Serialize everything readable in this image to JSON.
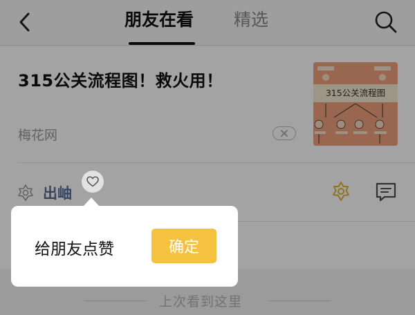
{
  "header": {
    "tabs": [
      {
        "label": "朋友在看",
        "active": true
      },
      {
        "label": "精选",
        "active": false
      }
    ],
    "back_icon": "chevron-left-icon",
    "search_icon": "search-icon"
  },
  "article": {
    "title": "315公关流程图！救火用！",
    "source": "梅花网",
    "thumbnail_caption": "315公关流程图",
    "dismiss_icon": "close-icon"
  },
  "friend_row": {
    "name": "出岫",
    "like_icon": "heart-icon",
    "wow_icon": "wow-icon",
    "comment_icon": "comment-icon"
  },
  "separator": {
    "text": "上次看到这里"
  },
  "popup": {
    "text": "给朋友点赞",
    "confirm_label": "确定"
  },
  "colors": {
    "accent": "#f4c23f",
    "name_link": "#576b95",
    "wow_gold": "#e2b533"
  }
}
